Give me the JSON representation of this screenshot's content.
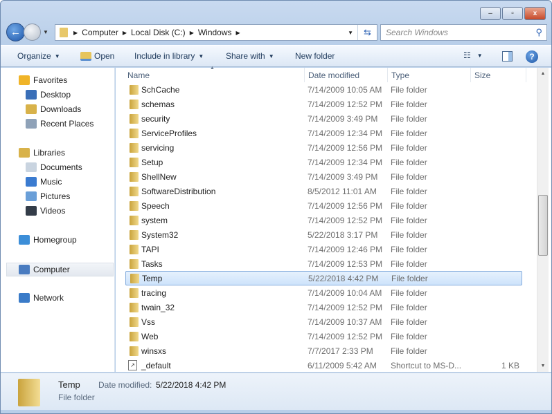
{
  "window": {
    "min": "–",
    "max": "▫",
    "close": "x"
  },
  "address": {
    "crumbs": [
      "Computer",
      "Local Disk (C:)",
      "Windows"
    ]
  },
  "search": {
    "placeholder": "Search Windows"
  },
  "toolbar": {
    "organize": "Organize",
    "open": "Open",
    "include": "Include in library",
    "share": "Share with",
    "new_folder": "New folder"
  },
  "sidebar": [
    {
      "label": "Favorites",
      "icon": "star-icon",
      "color": "#f0b428",
      "sub": false
    },
    {
      "label": "Desktop",
      "icon": "desktop-icon",
      "color": "#3a6fb8",
      "sub": true
    },
    {
      "label": "Downloads",
      "icon": "downloads-icon",
      "color": "#d8b24a",
      "sub": true
    },
    {
      "label": "Recent Places",
      "icon": "recent-places-icon",
      "color": "#8fa2b8",
      "sub": true
    },
    {
      "label": "Libraries",
      "icon": "libraries-icon",
      "color": "#d8b24a",
      "sub": false
    },
    {
      "label": "Documents",
      "icon": "documents-icon",
      "color": "#c9d4e0",
      "sub": true
    },
    {
      "label": "Music",
      "icon": "music-icon",
      "color": "#3a7bd0",
      "sub": true
    },
    {
      "label": "Pictures",
      "icon": "pictures-icon",
      "color": "#6a9fd8",
      "sub": true
    },
    {
      "label": "Videos",
      "icon": "videos-icon",
      "color": "#333c48",
      "sub": true
    },
    {
      "label": "Homegroup",
      "icon": "homegroup-icon",
      "color": "#3c8ed8",
      "sub": false
    },
    {
      "label": "Computer",
      "icon": "computer-icon",
      "color": "#4a7cc0",
      "sub": false,
      "selected": true
    },
    {
      "label": "Network",
      "icon": "network-icon",
      "color": "#3a7bc8",
      "sub": false
    }
  ],
  "columns": {
    "name": "Name",
    "date": "Date modified",
    "type": "Type",
    "size": "Size"
  },
  "files": [
    {
      "name": "SchCache",
      "date": "7/14/2009 10:05 AM",
      "type": "File folder",
      "size": ""
    },
    {
      "name": "schemas",
      "date": "7/14/2009 12:52 PM",
      "type": "File folder",
      "size": ""
    },
    {
      "name": "security",
      "date": "7/14/2009 3:49 PM",
      "type": "File folder",
      "size": ""
    },
    {
      "name": "ServiceProfiles",
      "date": "7/14/2009 12:34 PM",
      "type": "File folder",
      "size": ""
    },
    {
      "name": "servicing",
      "date": "7/14/2009 12:56 PM",
      "type": "File folder",
      "size": ""
    },
    {
      "name": "Setup",
      "date": "7/14/2009 12:34 PM",
      "type": "File folder",
      "size": ""
    },
    {
      "name": "ShellNew",
      "date": "7/14/2009 3:49 PM",
      "type": "File folder",
      "size": ""
    },
    {
      "name": "SoftwareDistribution",
      "date": "8/5/2012 11:01 AM",
      "type": "File folder",
      "size": ""
    },
    {
      "name": "Speech",
      "date": "7/14/2009 12:56 PM",
      "type": "File folder",
      "size": ""
    },
    {
      "name": "system",
      "date": "7/14/2009 12:52 PM",
      "type": "File folder",
      "size": ""
    },
    {
      "name": "System32",
      "date": "5/22/2018 3:17 PM",
      "type": "File folder",
      "size": ""
    },
    {
      "name": "TAPI",
      "date": "7/14/2009 12:46 PM",
      "type": "File folder",
      "size": ""
    },
    {
      "name": "Tasks",
      "date": "7/14/2009 12:53 PM",
      "type": "File folder",
      "size": ""
    },
    {
      "name": "Temp",
      "date": "5/22/2018 4:42 PM",
      "type": "File folder",
      "size": "",
      "selected": true
    },
    {
      "name": "tracing",
      "date": "7/14/2009 10:04 AM",
      "type": "File folder",
      "size": ""
    },
    {
      "name": "twain_32",
      "date": "7/14/2009 12:52 PM",
      "type": "File folder",
      "size": ""
    },
    {
      "name": "Vss",
      "date": "7/14/2009 10:37 AM",
      "type": "File folder",
      "size": ""
    },
    {
      "name": "Web",
      "date": "7/14/2009 12:52 PM",
      "type": "File folder",
      "size": ""
    },
    {
      "name": "winsxs",
      "date": "7/7/2017 2:33 PM",
      "type": "File folder",
      "size": ""
    },
    {
      "name": "_default",
      "date": "6/11/2009 5:42 AM",
      "type": "Shortcut to MS-D...",
      "size": "1 KB",
      "shortcut": true
    }
  ],
  "details": {
    "name": "Temp",
    "date_label": "Date modified:",
    "date": "5/22/2018 4:42 PM",
    "type": "File folder"
  }
}
